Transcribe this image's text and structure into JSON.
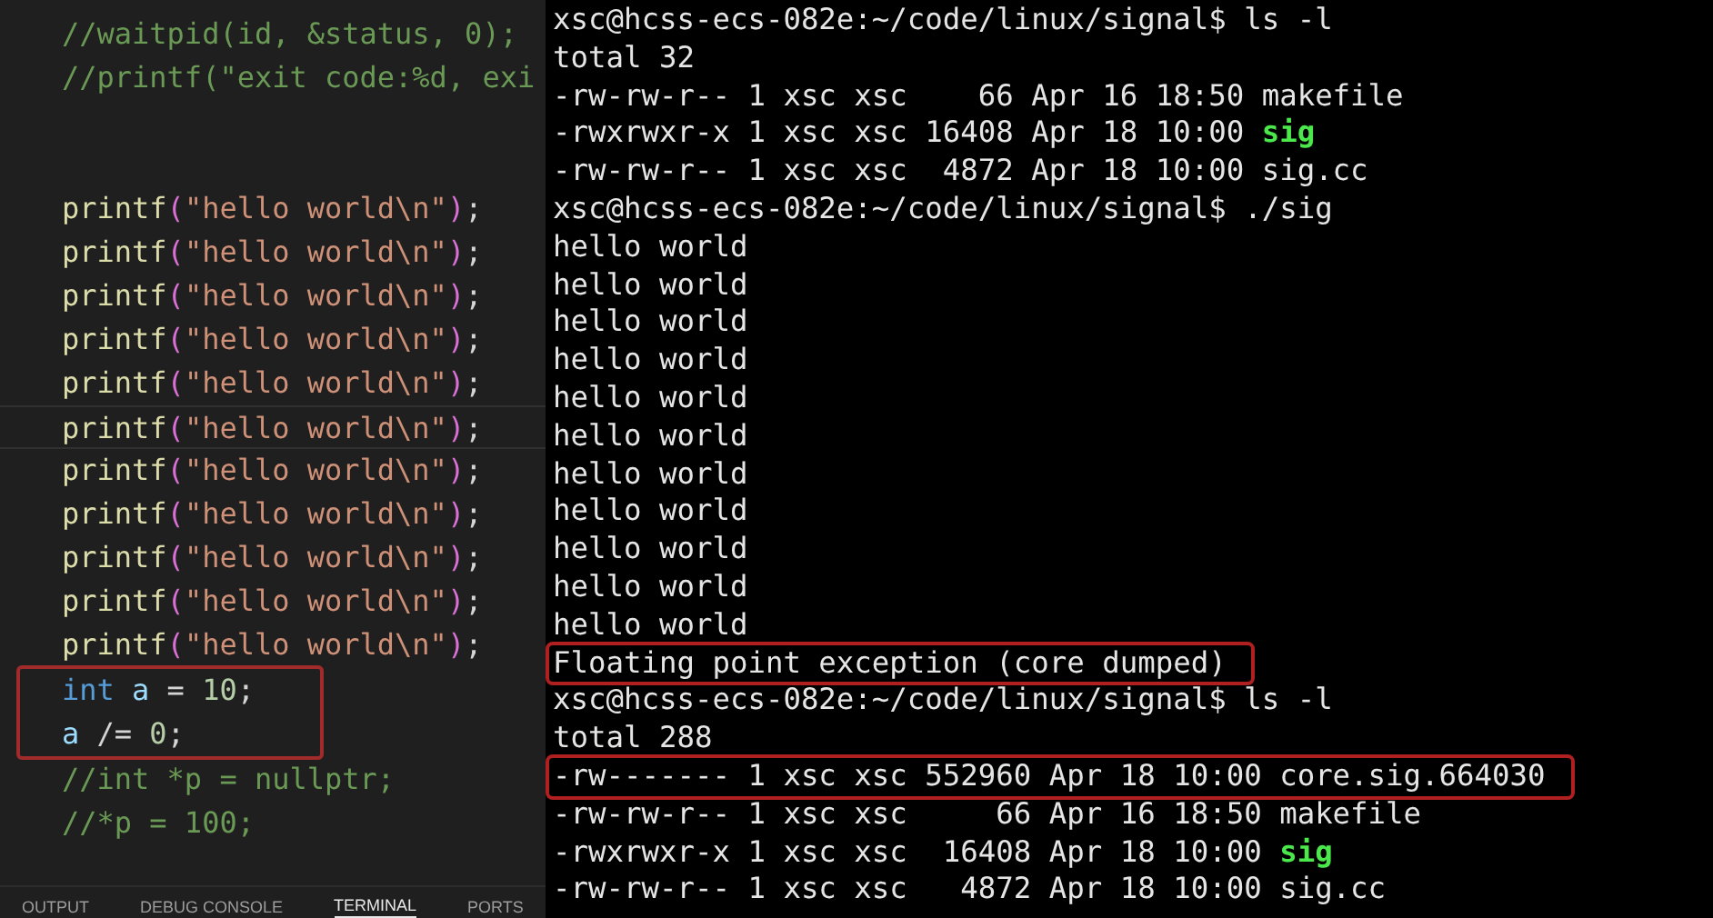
{
  "editor": {
    "lines": [
      {
        "kind": "code",
        "current": false,
        "boxed": false,
        "tokens": [
          {
            "kind": "comment",
            "text": "//waitpid(id, &status, 0);"
          }
        ]
      },
      {
        "kind": "code",
        "current": false,
        "boxed": false,
        "tokens": [
          {
            "kind": "comment",
            "text": "//printf(\"exit code:%d, exi"
          }
        ]
      },
      {
        "kind": "blank",
        "current": false,
        "boxed": false
      },
      {
        "kind": "blank",
        "current": false,
        "boxed": false
      },
      {
        "kind": "code",
        "current": false,
        "boxed": false,
        "tokens": [
          {
            "kind": "function",
            "text": "printf"
          },
          {
            "kind": "bracket",
            "text": "("
          },
          {
            "kind": "string",
            "text": "\"hello world\\n\""
          },
          {
            "kind": "bracket",
            "text": ")"
          },
          {
            "kind": "punct",
            "text": ";"
          }
        ]
      },
      {
        "kind": "code",
        "current": false,
        "boxed": false,
        "tokens": [
          {
            "kind": "function",
            "text": "printf"
          },
          {
            "kind": "bracket",
            "text": "("
          },
          {
            "kind": "string",
            "text": "\"hello world\\n\""
          },
          {
            "kind": "bracket",
            "text": ")"
          },
          {
            "kind": "punct",
            "text": ";"
          }
        ]
      },
      {
        "kind": "code",
        "current": false,
        "boxed": false,
        "tokens": [
          {
            "kind": "function",
            "text": "printf"
          },
          {
            "kind": "bracket",
            "text": "("
          },
          {
            "kind": "string",
            "text": "\"hello world\\n\""
          },
          {
            "kind": "bracket",
            "text": ")"
          },
          {
            "kind": "punct",
            "text": ";"
          }
        ]
      },
      {
        "kind": "code",
        "current": false,
        "boxed": false,
        "tokens": [
          {
            "kind": "function",
            "text": "printf"
          },
          {
            "kind": "bracket",
            "text": "("
          },
          {
            "kind": "string",
            "text": "\"hello world\\n\""
          },
          {
            "kind": "bracket",
            "text": ")"
          },
          {
            "kind": "punct",
            "text": ";"
          }
        ]
      },
      {
        "kind": "code",
        "current": false,
        "boxed": false,
        "tokens": [
          {
            "kind": "function",
            "text": "printf"
          },
          {
            "kind": "bracket",
            "text": "("
          },
          {
            "kind": "string",
            "text": "\"hello world\\n\""
          },
          {
            "kind": "bracket",
            "text": ")"
          },
          {
            "kind": "punct",
            "text": ";"
          }
        ]
      },
      {
        "kind": "code",
        "current": true,
        "boxed": false,
        "tokens": [
          {
            "kind": "function",
            "text": "printf"
          },
          {
            "kind": "bracket",
            "text": "("
          },
          {
            "kind": "string",
            "text": "\"hello world\\n\""
          },
          {
            "kind": "bracket",
            "text": ")"
          },
          {
            "kind": "punct",
            "text": ";"
          }
        ]
      },
      {
        "kind": "code",
        "current": false,
        "boxed": false,
        "tokens": [
          {
            "kind": "function",
            "text": "printf"
          },
          {
            "kind": "bracket",
            "text": "("
          },
          {
            "kind": "string",
            "text": "\"hello world\\n\""
          },
          {
            "kind": "bracket",
            "text": ")"
          },
          {
            "kind": "punct",
            "text": ";"
          }
        ]
      },
      {
        "kind": "code",
        "current": false,
        "boxed": false,
        "tokens": [
          {
            "kind": "function",
            "text": "printf"
          },
          {
            "kind": "bracket",
            "text": "("
          },
          {
            "kind": "string",
            "text": "\"hello world\\n\""
          },
          {
            "kind": "bracket",
            "text": ")"
          },
          {
            "kind": "punct",
            "text": ";"
          }
        ]
      },
      {
        "kind": "code",
        "current": false,
        "boxed": false,
        "tokens": [
          {
            "kind": "function",
            "text": "printf"
          },
          {
            "kind": "bracket",
            "text": "("
          },
          {
            "kind": "string",
            "text": "\"hello world\\n\""
          },
          {
            "kind": "bracket",
            "text": ")"
          },
          {
            "kind": "punct",
            "text": ";"
          }
        ]
      },
      {
        "kind": "code",
        "current": false,
        "boxed": false,
        "tokens": [
          {
            "kind": "function",
            "text": "printf"
          },
          {
            "kind": "bracket",
            "text": "("
          },
          {
            "kind": "string",
            "text": "\"hello world\\n\""
          },
          {
            "kind": "bracket",
            "text": ")"
          },
          {
            "kind": "punct",
            "text": ";"
          }
        ]
      },
      {
        "kind": "code",
        "current": false,
        "boxed": false,
        "tokens": [
          {
            "kind": "function",
            "text": "printf"
          },
          {
            "kind": "bracket",
            "text": "("
          },
          {
            "kind": "string",
            "text": "\"hello world\\n\""
          },
          {
            "kind": "bracket",
            "text": ")"
          },
          {
            "kind": "punct",
            "text": ";"
          }
        ]
      },
      {
        "kind": "code",
        "current": false,
        "boxed": true,
        "tokens": [
          {
            "kind": "keyword",
            "text": "int"
          },
          {
            "kind": "variable",
            "text": "a",
            "space_before": true
          },
          {
            "kind": "punct",
            "text": " = "
          },
          {
            "kind": "number",
            "text": "10"
          },
          {
            "kind": "punct",
            "text": ";"
          }
        ]
      },
      {
        "kind": "code",
        "current": false,
        "boxed": true,
        "tokens": [
          {
            "kind": "variable",
            "text": "a"
          },
          {
            "kind": "punct",
            "text": " /= "
          },
          {
            "kind": "number",
            "text": "0"
          },
          {
            "kind": "punct",
            "text": ";"
          }
        ]
      },
      {
        "kind": "code",
        "current": false,
        "boxed": false,
        "tokens": [
          {
            "kind": "comment",
            "text": "//int *p = nullptr;"
          }
        ]
      },
      {
        "kind": "code",
        "current": false,
        "boxed": false,
        "tokens": [
          {
            "kind": "comment",
            "text": "//*p = 100;"
          }
        ]
      }
    ]
  },
  "panel_tabs": [
    {
      "label": "OUTPUT",
      "selected": false
    },
    {
      "label": "DEBUG CONSOLE",
      "selected": false
    },
    {
      "label": "TERMINAL",
      "selected": true
    },
    {
      "label": "PORTS",
      "selected": false
    }
  ],
  "terminal": {
    "lines": [
      {
        "boxed": false,
        "segments": [
          {
            "kind": "plain",
            "text": "xsc@hcss-ecs-082e:~/code/linux/signal$ ls -l"
          }
        ]
      },
      {
        "boxed": false,
        "segments": [
          {
            "kind": "plain",
            "text": "total 32"
          }
        ]
      },
      {
        "boxed": false,
        "segments": [
          {
            "kind": "plain",
            "text": "-rw-rw-r-- 1 xsc xsc    66 Apr 16 18:50 makefile"
          }
        ]
      },
      {
        "boxed": false,
        "segments": [
          {
            "kind": "plain",
            "text": "-rwxrwxr-x 1 xsc xsc 16408 Apr 18 10:00 "
          },
          {
            "kind": "executable",
            "text": "sig"
          }
        ]
      },
      {
        "boxed": false,
        "segments": [
          {
            "kind": "plain",
            "text": "-rw-rw-r-- 1 xsc xsc  4872 Apr 18 10:00 sig.cc"
          }
        ]
      },
      {
        "boxed": false,
        "segments": [
          {
            "kind": "plain",
            "text": "xsc@hcss-ecs-082e:~/code/linux/signal$ ./sig"
          }
        ]
      },
      {
        "boxed": false,
        "segments": [
          {
            "kind": "plain",
            "text": "hello world"
          }
        ]
      },
      {
        "boxed": false,
        "segments": [
          {
            "kind": "plain",
            "text": "hello world"
          }
        ]
      },
      {
        "boxed": false,
        "segments": [
          {
            "kind": "plain",
            "text": "hello world"
          }
        ]
      },
      {
        "boxed": false,
        "segments": [
          {
            "kind": "plain",
            "text": "hello world"
          }
        ]
      },
      {
        "boxed": false,
        "segments": [
          {
            "kind": "plain",
            "text": "hello world"
          }
        ]
      },
      {
        "boxed": false,
        "segments": [
          {
            "kind": "plain",
            "text": "hello world"
          }
        ]
      },
      {
        "boxed": false,
        "segments": [
          {
            "kind": "plain",
            "text": "hello world"
          }
        ]
      },
      {
        "boxed": false,
        "segments": [
          {
            "kind": "plain",
            "text": "hello world"
          }
        ]
      },
      {
        "boxed": false,
        "segments": [
          {
            "kind": "plain",
            "text": "hello world"
          }
        ]
      },
      {
        "boxed": false,
        "segments": [
          {
            "kind": "plain",
            "text": "hello world"
          }
        ]
      },
      {
        "boxed": false,
        "segments": [
          {
            "kind": "plain",
            "text": "hello world"
          }
        ]
      },
      {
        "boxed": true,
        "segments": [
          {
            "kind": "plain",
            "text": "Floating point exception (core dumped)"
          }
        ]
      },
      {
        "boxed": false,
        "segments": [
          {
            "kind": "plain",
            "text": "xsc@hcss-ecs-082e:~/code/linux/signal$ ls -l"
          }
        ]
      },
      {
        "boxed": false,
        "segments": [
          {
            "kind": "plain",
            "text": "total 288"
          }
        ]
      },
      {
        "boxed": true,
        "segments": [
          {
            "kind": "plain",
            "text": "-rw------- 1 xsc xsc 552960 Apr 18 10:00 core.sig.664030"
          }
        ]
      },
      {
        "boxed": false,
        "segments": [
          {
            "kind": "plain",
            "text": "-rw-rw-r-- 1 xsc xsc     66 Apr 16 18:50 makefile"
          }
        ]
      },
      {
        "boxed": false,
        "segments": [
          {
            "kind": "plain",
            "text": "-rwxrwxr-x 1 xsc xsc  16408 Apr 18 10:00 "
          },
          {
            "kind": "executable",
            "text": "sig"
          }
        ]
      },
      {
        "boxed": false,
        "segments": [
          {
            "kind": "plain",
            "text": "-rw-rw-r-- 1 xsc xsc   4872 Apr 18 10:00 sig.cc"
          }
        ]
      }
    ]
  }
}
